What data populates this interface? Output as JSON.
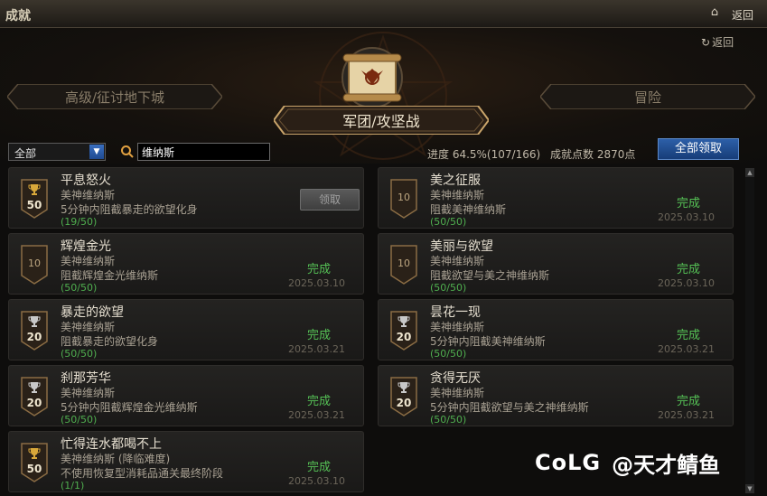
{
  "window": {
    "title": "成就",
    "back_label": "返回"
  },
  "header": {
    "back_label": "返回",
    "nav_left": "高级/征讨地下城",
    "nav_center": "军团/攻坚战",
    "nav_right": "冒险"
  },
  "filter": {
    "category_selected": "全部",
    "search_value": "维纳斯",
    "progress_text": "进度 64.5%(107/166)",
    "points_text": "成就点数 2870点",
    "claim_all_label": "全部领取"
  },
  "achievements": [
    {
      "name": "平息怒火",
      "sub1": "美神维纳斯",
      "sub2": "5分钟内阻截暴走的欲望化身",
      "progress": "(19/50)",
      "badge": "50",
      "badge_type": "gold",
      "status": "",
      "date": "",
      "claim_label": "领取"
    },
    {
      "name": "美之征服",
      "sub1": "美神维纳斯",
      "sub2": "阻截美神维纳斯",
      "progress": "(50/50)",
      "badge": "10",
      "badge_type": "plain",
      "status": "完成",
      "date": "2025.03.10",
      "claim_label": ""
    },
    {
      "name": "辉煌金光",
      "sub1": "美神维纳斯",
      "sub2": "阻截辉煌金光维纳斯",
      "progress": "(50/50)",
      "badge": "10",
      "badge_type": "plain",
      "status": "完成",
      "date": "2025.03.10",
      "claim_label": ""
    },
    {
      "name": "美丽与欲望",
      "sub1": "美神维纳斯",
      "sub2": "阻截欲望与美之神维纳斯",
      "progress": "(50/50)",
      "badge": "10",
      "badge_type": "plain",
      "status": "完成",
      "date": "2025.03.10",
      "claim_label": ""
    },
    {
      "name": "暴走的欲望",
      "sub1": "美神维纳斯",
      "sub2": "阻截暴走的欲望化身",
      "progress": "(50/50)",
      "badge": "20",
      "badge_type": "silver",
      "status": "完成",
      "date": "2025.03.21",
      "claim_label": ""
    },
    {
      "name": "昙花一现",
      "sub1": "美神维纳斯",
      "sub2": "5分钟内阻截美神维纳斯",
      "progress": "(50/50)",
      "badge": "20",
      "badge_type": "silver",
      "status": "完成",
      "date": "2025.03.21",
      "claim_label": ""
    },
    {
      "name": "刹那芳华",
      "sub1": "美神维纳斯",
      "sub2": "5分钟内阻截辉煌金光维纳斯",
      "progress": "(50/50)",
      "badge": "20",
      "badge_type": "silver",
      "status": "完成",
      "date": "2025.03.21",
      "claim_label": ""
    },
    {
      "name": "贪得无厌",
      "sub1": "美神维纳斯",
      "sub2": "5分钟内阻截欲望与美之神维纳斯",
      "progress": "(50/50)",
      "badge": "20",
      "badge_type": "silver",
      "status": "完成",
      "date": "2025.03.21",
      "claim_label": ""
    },
    {
      "name": "忙得连水都喝不上",
      "sub1": "美神维纳斯 (降临难度)",
      "sub2": "不使用恢复型消耗品通关最终阶段",
      "progress": "(1/1)",
      "badge": "50",
      "badge_type": "gold",
      "status": "完成",
      "date": "2025.03.10",
      "claim_label": ""
    }
  ],
  "watermark": {
    "logo": "CoLG",
    "text": "@天才鲭鱼"
  },
  "colors": {
    "complete": "#55c055",
    "accent_blue": "#2d5fa8",
    "gold": "#d9a83a",
    "silver": "#c8c8c8"
  }
}
